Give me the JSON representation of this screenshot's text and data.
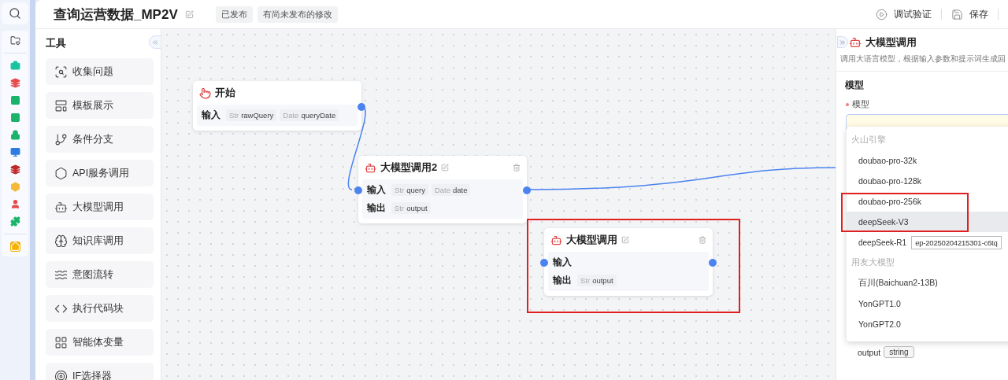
{
  "header": {
    "title": "查询运营数据_MP2V",
    "tags": [
      "已发布",
      "有尚未发布的修改"
    ],
    "actions": [
      {
        "kind": "debug",
        "label": "调试验证"
      },
      {
        "kind": "save",
        "label": "保存"
      }
    ]
  },
  "tools": {
    "heading": "工具",
    "items": [
      {
        "label": "收集问题"
      },
      {
        "label": "模板展示"
      },
      {
        "label": "条件分支"
      },
      {
        "label": "API服务调用"
      },
      {
        "label": "大模型调用"
      },
      {
        "label": "知识库调用"
      },
      {
        "label": "意图流转"
      },
      {
        "label": "执行代码块"
      },
      {
        "label": "智能体变量"
      },
      {
        "label": "IF选择器"
      }
    ]
  },
  "nodes": [
    {
      "kind": "start",
      "title": "开始",
      "rows": [
        {
          "label": "输入",
          "params": [
            {
              "type": "Str",
              "name": "rawQuery"
            },
            {
              "type": "Date",
              "name": "queryDate"
            }
          ]
        }
      ]
    },
    {
      "kind": "llm",
      "title": "大模型调用2",
      "rows": [
        {
          "label": "输入",
          "params": [
            {
              "type": "Str",
              "name": "query"
            },
            {
              "type": "Date",
              "name": "date"
            }
          ]
        },
        {
          "label": "输出",
          "params": [
            {
              "type": "Str",
              "name": "output"
            }
          ]
        }
      ]
    },
    {
      "kind": "llm",
      "title": "大模型调用",
      "rows": [
        {
          "label": "输入",
          "params": []
        },
        {
          "label": "输出",
          "params": [
            {
              "type": "Str",
              "name": "output"
            }
          ]
        }
      ]
    }
  ],
  "panel": {
    "title": "大模型调用",
    "description": "调用大语言模型，根据输入参数和提示词生成回",
    "section": "模型",
    "field": {
      "label": "模型",
      "required": true
    },
    "dropdown": {
      "groups": [
        {
          "label": "火山引擎",
          "options": [
            {
              "label": "doubao-pro-32k",
              "selected": false
            },
            {
              "label": "doubao-pro-128k",
              "selected": false
            },
            {
              "label": "doubao-pro-256k",
              "selected": false
            },
            {
              "label": "deepSeek-V3",
              "selected": true
            },
            {
              "label": "deepSeek-R1",
              "selected": false,
              "tooltip": "ep-20250204215301-c6tq"
            }
          ]
        },
        {
          "label": "用友大模型",
          "options": [
            {
              "label": "百川(Baichuan2-13B)",
              "selected": false
            },
            {
              "label": "YonGPT1.0",
              "selected": false
            },
            {
              "label": "YonGPT2.0",
              "selected": false
            }
          ]
        }
      ]
    },
    "output": {
      "name": "output",
      "type": "string"
    }
  }
}
